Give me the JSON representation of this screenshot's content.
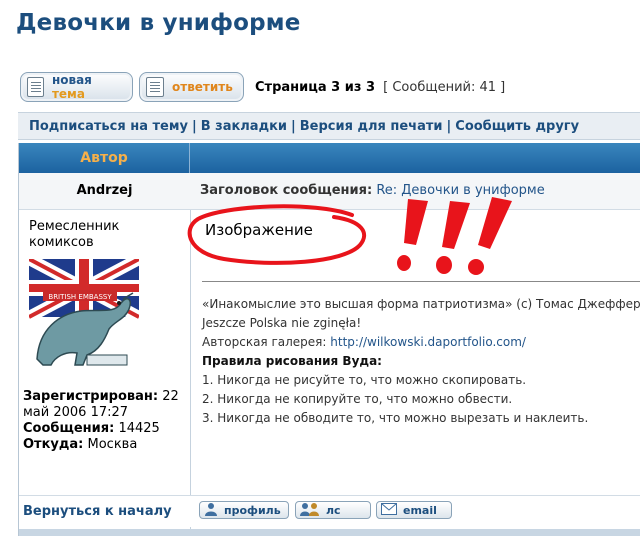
{
  "page": {
    "title": "Девочки в униформе"
  },
  "buttons": {
    "new_topic_prefix": "новая",
    "new_topic_suffix": "тема",
    "reply": "ответить"
  },
  "pagination": {
    "page_text": "Страница 3 из 3",
    "messages_count": "[ Сообщений: 41 ]"
  },
  "nav_links": {
    "subscribe": "Подписаться на тему",
    "bookmarks": "В закладки",
    "print": "Версия для печати",
    "tell_friend": "Сообщить другу",
    "separator": "|"
  },
  "table": {
    "author_header": "Автор"
  },
  "post": {
    "author": "Andrzej",
    "subject_label": "Заголовок сообщения:",
    "subject_value": "Re: Девочки в униформе",
    "rank": "Ремесленник комиксов",
    "avatar_text": "BRITISH EMBASSY",
    "image_placeholder": "Изображение",
    "registered_label": "Зарегистрирован:",
    "registered_value": "22 май 2006 17:27",
    "posts_label": "Сообщения:",
    "posts_value": "14425",
    "from_label": "Откуда:",
    "from_value": "Москва",
    "signature": {
      "quote": "«Инакомыслие это высшая форма патриотизма» (c) Томас Джефферсон",
      "polish": "Jeszcze Polska nie zginęła!",
      "gallery_label": "Авторская галерея:",
      "gallery_url": "http://wilkowski.daportfolio.com/",
      "rules_title": "Правила рисования Вуда:",
      "rule1": "1. Никогда не рисуйте то, что можно скопировать.",
      "rule2": "2. Никогда не копируйте то, что можно обвести.",
      "rule3": "3. Никогда не обводите то, что можно вырезать и наклеить."
    }
  },
  "footer": {
    "back_to_top": "Вернуться к началу",
    "profile": "профиль",
    "pm": "лс",
    "email": "email"
  },
  "colors": {
    "link": "#1c4e7e",
    "header_gradient_top": "#3a86bd",
    "accent_orange": "#f6b04a",
    "annotation_red": "#e8141b"
  }
}
